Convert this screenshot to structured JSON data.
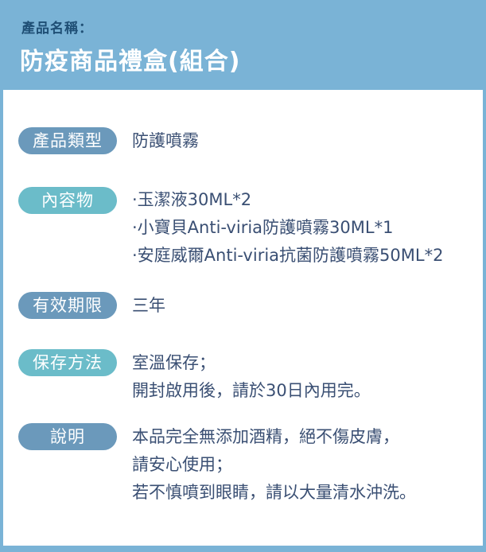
{
  "header": {
    "subtitle": "產品名稱：",
    "title": "防疫商品禮盒(組合)"
  },
  "rows": {
    "type": {
      "label": "產品類型",
      "lines": [
        "防護噴霧"
      ]
    },
    "contents": {
      "label": "內容物",
      "lines": [
        "·玉潔液30ML*2",
        "·小寶貝Anti-viria防護噴霧30ML*1",
        "·安庭威爾Anti-viria抗菌防護噴霧50ML*2"
      ]
    },
    "expiry": {
      "label": "有效期限",
      "lines": [
        "三年"
      ]
    },
    "storage": {
      "label": "保存方法",
      "lines": [
        "室溫保存；",
        "開封啟用後，請於30日內用完。"
      ]
    },
    "notes": {
      "label": "說明",
      "lines": [
        "本品完全無添加酒精，絕不傷皮膚，",
        "請安心使用；",
        "若不慎噴到眼睛，請以大量清水沖洗。"
      ]
    }
  },
  "colors": {
    "header_bg": "#7ab3d6",
    "tag_dark": "#6b99bb",
    "tag_light": "#6bbcc9",
    "value_text": "#3a4f73",
    "subtitle_text": "#1f4f75"
  }
}
